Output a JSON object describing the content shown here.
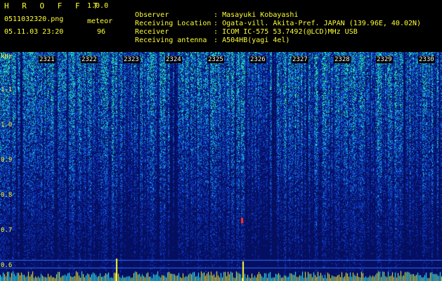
{
  "header": {
    "app_title": "H R O F F T",
    "app_version": "1.0.0",
    "file_name": "0511032320.png",
    "mode_label": "meteor",
    "datetime": "05.11.03 23:20",
    "count_value": "96"
  },
  "info": [
    {
      "key": "Observer",
      "value": ": Masayuki Kobayashi"
    },
    {
      "key": "Receiving Location",
      "value": ": Ogata-vill. Akita-Pref. JAPAN (139.96E, 40.02N)"
    },
    {
      "key": "Receiver",
      "value": ": ICOM IC-575 53.7492(@LCD)MHz USB"
    },
    {
      "key": "Receiving antenna",
      "value": ": A504HB(yagi 4el)"
    }
  ],
  "axis": {
    "y_unit": "kHz",
    "y_ticks": [
      "1.1",
      "1.0",
      "0.9",
      "0.8",
      "0.7",
      "0.6"
    ],
    "x_ticks": [
      "2321",
      "2322",
      "2323",
      "2324",
      "2325",
      "2326",
      "2327",
      "2328",
      "2329",
      "2330"
    ]
  },
  "colors": {
    "header_text": "#ffff33",
    "info_text": "#33ffff",
    "background": "#000000",
    "signal_low": "#0a1a8c",
    "signal_high": "#33ffcc"
  }
}
